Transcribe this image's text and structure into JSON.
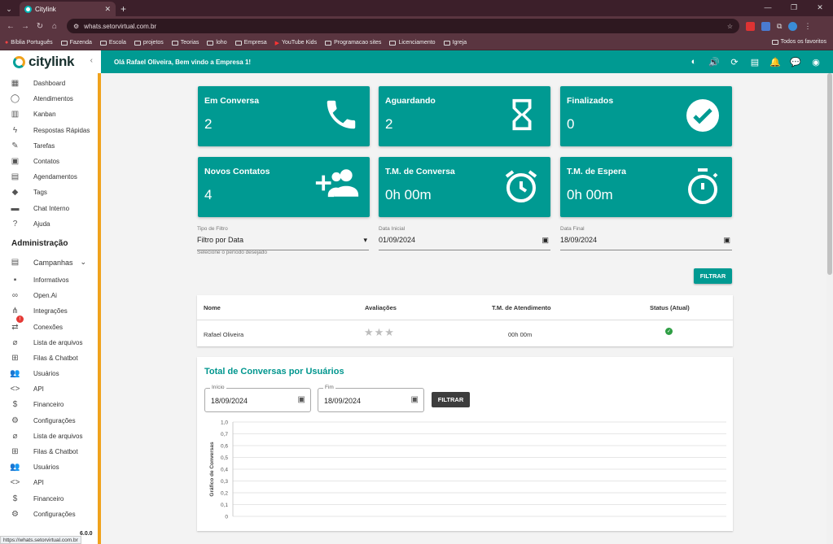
{
  "browser": {
    "tab_title": "Citylink",
    "url": "whats.setorvirtual.com.br",
    "status_url": "https://whats.setorvirtual.com.br",
    "bookmarks": [
      "Bíblia Português",
      "Fazenda",
      "Escola",
      "projetos",
      "Teorias",
      "loho",
      "Empresa",
      "YouTube Kids",
      "Programacao sites",
      "Licenciamento",
      "Igreja"
    ],
    "bookmarks_right": "Todos os favoritos"
  },
  "app": {
    "brand": "citylink",
    "welcome": "Olá Rafael Oliveira, Bem vindo a Empresa 1!",
    "version": "6.0.0"
  },
  "sidebar": {
    "items": [
      "Dashboard",
      "Atendimentos",
      "Kanban",
      "Respostas Rápidas",
      "Tarefas",
      "Contatos",
      "Agendamentos",
      "Tags",
      "Chat Interno",
      "Ajuda"
    ],
    "admin_heading": "Administração",
    "campaigns": "Campanhas",
    "admin_items": [
      "Informativos",
      "Open.Ai",
      "Integrações",
      "Conexões",
      "Lista de arquivos",
      "Filas & Chatbot",
      "Usuários",
      "API",
      "Financeiro",
      "Configurações",
      "Lista de arquivos",
      "Filas & Chatbot",
      "Usuários",
      "API",
      "Financeiro",
      "Configurações"
    ],
    "conexoes_badge": "!"
  },
  "cards": [
    {
      "title": "Em Conversa",
      "value": "2",
      "icon": "phone-icon"
    },
    {
      "title": "Aguardando",
      "value": "2",
      "icon": "hourglass-icon"
    },
    {
      "title": "Finalizados",
      "value": "0",
      "icon": "check-circle-icon"
    },
    {
      "title": "Novos Contatos",
      "value": "4",
      "icon": "add-group-icon"
    },
    {
      "title": "T.M. de Conversa",
      "value": "0h 00m",
      "icon": "alarm-icon"
    },
    {
      "title": "T.M. de Espera",
      "value": "0h 00m",
      "icon": "timer-icon"
    }
  ],
  "filter": {
    "type_label": "Tipo de Filtro",
    "type_value": "Filtro por Data",
    "type_hint": "Selecione o período desejado",
    "start_label": "Data Inicial",
    "start_value": "01/09/2024",
    "end_label": "Data Final",
    "end_value": "18/09/2024",
    "button": "FILTRAR"
  },
  "table": {
    "headers": [
      "Nome",
      "Avaliações",
      "T.M. de Atendimento",
      "Status (Atual)"
    ],
    "rows": [
      {
        "name": "Rafael Oliveira",
        "rating": 0,
        "tm": "00h 00m",
        "status": "online"
      }
    ]
  },
  "chart_section": {
    "title": "Total de Conversas por Usuários",
    "start_label": "Início",
    "start_value": "18/09/2024",
    "end_label": "Fim",
    "end_value": "18/09/2024",
    "button": "FILTRAR"
  },
  "chart_data": {
    "type": "bar",
    "categories": [],
    "series": [],
    "ylabel": "Gráfico de Conversas",
    "yticks": [
      "1,0",
      "0,7",
      "0,6",
      "0,5",
      "0,4",
      "0,3",
      "0,2",
      "0,1",
      "0"
    ],
    "ylim": [
      0,
      1
    ],
    "grid": true
  },
  "colors": {
    "primary": "#009a92",
    "accent": "#f0a21c",
    "success": "#2e9e44"
  }
}
